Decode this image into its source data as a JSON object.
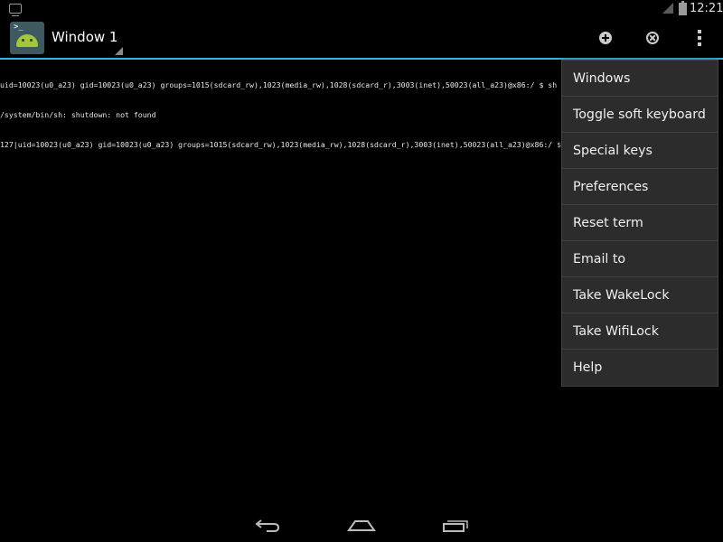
{
  "status_bar": {
    "time": "12:21"
  },
  "action_bar": {
    "window_title": "Window 1",
    "icons": {
      "add": "add-circle-icon",
      "close": "close-circle-icon",
      "overflow": "overflow-menu-icon"
    }
  },
  "terminal": {
    "lines": [
      "uid=10023(u0_a23) gid=10023(u0_a23) groups=1015(sdcard_rw),1023(media_rw),1028(sdcard_r),3003(inet),50023(all_a23)@x86:/ $ sh",
      "/system/bin/sh: shutdown: not found",
      "127|uid=10023(u0_a23) gid=10023(u0_a23) groups=1015(sdcard_rw),1023(media_rw),1028(sdcard_r),3003(inet),50023(all_a23)@x86:/ $"
    ]
  },
  "menu": {
    "items": [
      "Windows",
      "Toggle soft keyboard",
      "Special keys",
      "Preferences",
      "Reset term",
      "Email to",
      "Take WakeLock",
      "Take WifiLock",
      "Help"
    ]
  },
  "colors": {
    "accent": "#33b5e5",
    "menu_bg": "#2c2c2c",
    "background": "#000000"
  }
}
